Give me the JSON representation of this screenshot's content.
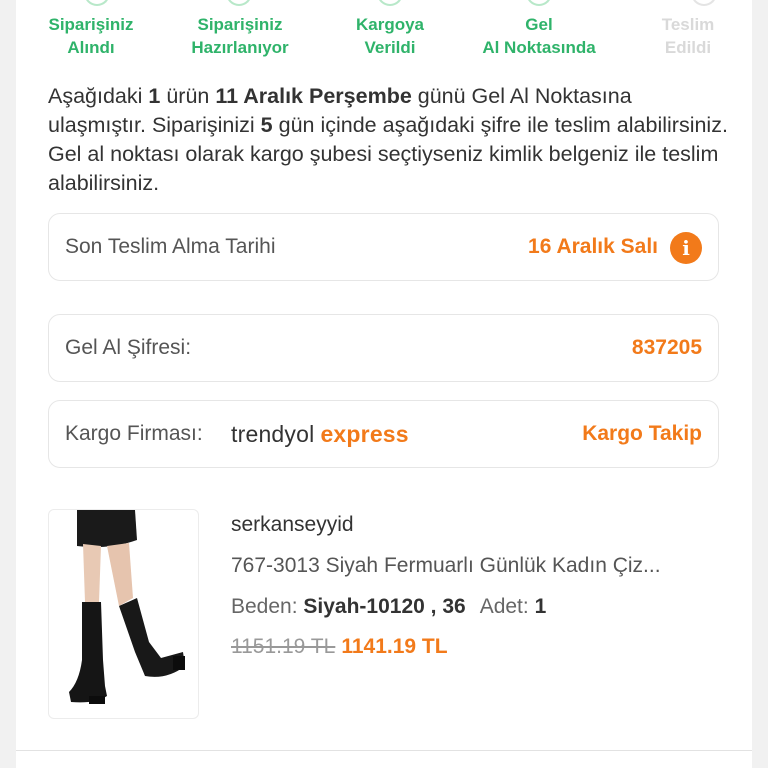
{
  "steps": [
    {
      "label": "Siparişiniz\nAlındı",
      "state": "done"
    },
    {
      "label": "Siparişiniz\nHazırlanıyor",
      "state": "done"
    },
    {
      "label": "Kargoya\nVerildi",
      "state": "done"
    },
    {
      "label": "Gel\nAl Noktasında",
      "state": "done"
    },
    {
      "label": "Teslim\nEdildi",
      "state": "pending"
    }
  ],
  "intro": {
    "p1": "Aşağıdaki ",
    "count": "1",
    "p2": " ürün ",
    "date": "11 Aralık Perşembe",
    "p3": " günü Gel Al Noktasına ulaşmıştır. Siparişinizi ",
    "days": "5",
    "p4": " gün içinde aşağıdaki şifre ile teslim alabilirsiniz. Gel al noktası olarak kargo şubesi seçtiyseniz kimlik belgeniz ile teslim alabilirsiniz."
  },
  "deadline": {
    "label": "Son Teslim Alma Tarihi",
    "value": "16 Aralık Salı",
    "icon": "info-icon"
  },
  "pickup_code": {
    "label": "Gel Al Şifresi:",
    "value": "837205"
  },
  "cargo": {
    "label": "Kargo Firması:",
    "brand_part1": "trendyol",
    "brand_part2": "express",
    "link": "Kargo Takip"
  },
  "product": {
    "seller": "serkanseyyid",
    "name": "767-3013 Siyah Fermuarlı Günlük Kadın Çiz...",
    "size_label": "Beden:",
    "size_value": "Siyah-10120 , 36",
    "qty_label": "Adet:",
    "qty_value": "1",
    "old_price": "1151.19 TL",
    "new_price": "1141.19 TL"
  },
  "colors": {
    "accent": "#f27a1a",
    "success": "#2fb36a"
  }
}
